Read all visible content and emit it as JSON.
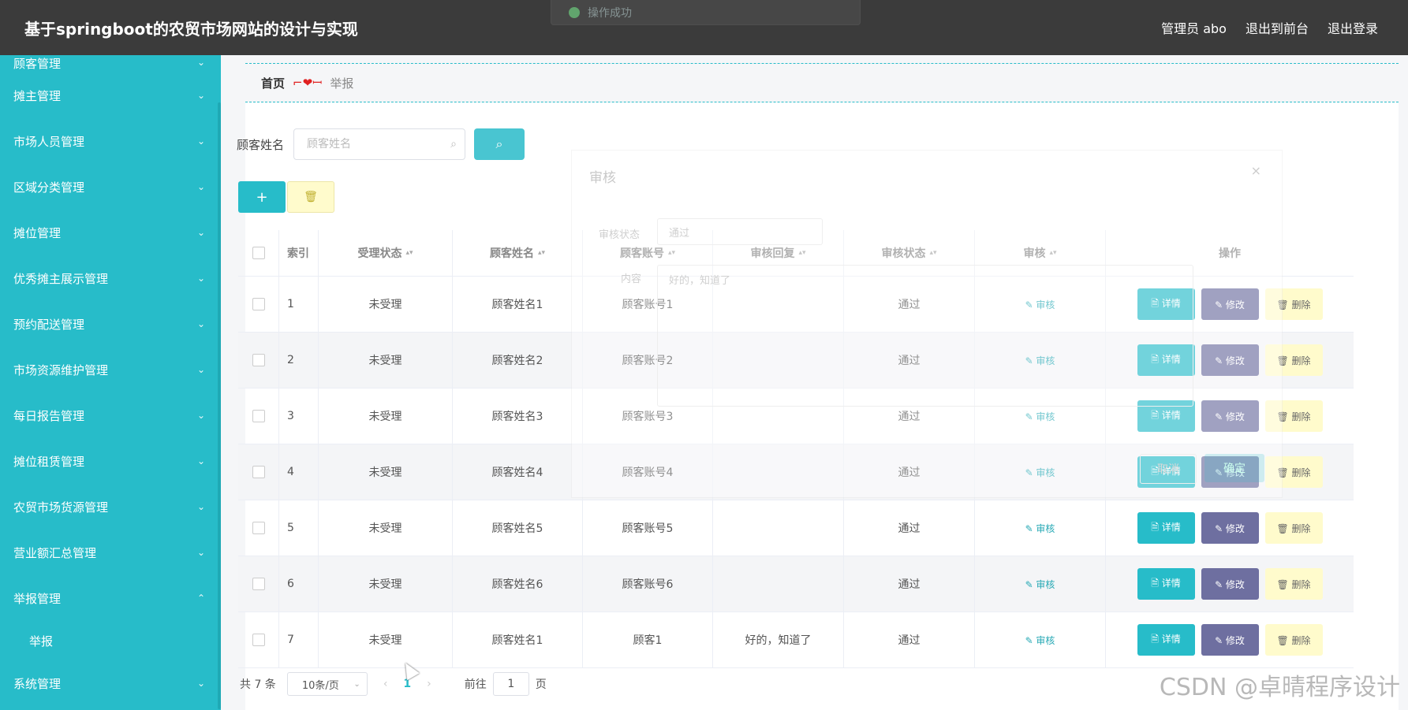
{
  "header": {
    "title": "基于springboot的农贸市场网站的设计与实现",
    "user": "管理员 abo",
    "to_front": "退出到前台",
    "logout": "退出登录"
  },
  "toast": {
    "text": "操作成功"
  },
  "sidebar": {
    "items": [
      {
        "label": "顾客管理"
      },
      {
        "label": "摊主管理"
      },
      {
        "label": "市场人员管理"
      },
      {
        "label": "区域分类管理"
      },
      {
        "label": "摊位管理"
      },
      {
        "label": "优秀摊主展示管理"
      },
      {
        "label": "预约配送管理"
      },
      {
        "label": "市场资源维护管理"
      },
      {
        "label": "每日报告管理"
      },
      {
        "label": "摊位租赁管理"
      },
      {
        "label": "农贸市场货源管理"
      },
      {
        "label": "营业额汇总管理"
      },
      {
        "label": "举报管理"
      },
      {
        "label": "系统管理"
      }
    ],
    "sub_item": "举报",
    "chev_down": "⌄",
    "chev_up": "⌃"
  },
  "breadcrumb": {
    "home": "首页",
    "sep": "⌐❤ꟷ",
    "current": "举报"
  },
  "search": {
    "label": "顾客姓名",
    "placeholder": "顾客姓名"
  },
  "buttons": {
    "add": "+",
    "delete_icon": "🗑"
  },
  "table": {
    "headers": [
      "索引",
      "受理状态",
      "顾客姓名",
      "顾客账号",
      "审核回复",
      "审核状态",
      "审核",
      "操作"
    ],
    "sort_icon": "▴▾",
    "rows": [
      {
        "index": "1",
        "status": "未受理",
        "name": "顾客姓名1",
        "account": "顾客账号1",
        "reply": "",
        "audit_status": "通过"
      },
      {
        "index": "2",
        "status": "未受理",
        "name": "顾客姓名2",
        "account": "顾客账号2",
        "reply": "",
        "audit_status": "通过"
      },
      {
        "index": "3",
        "status": "未受理",
        "name": "顾客姓名3",
        "account": "顾客账号3",
        "reply": "",
        "audit_status": "通过"
      },
      {
        "index": "4",
        "status": "未受理",
        "name": "顾客姓名4",
        "account": "顾客账号4",
        "reply": "",
        "audit_status": "通过"
      },
      {
        "index": "5",
        "status": "未受理",
        "name": "顾客姓名5",
        "account": "顾客账号5",
        "reply": "",
        "audit_status": "通过"
      },
      {
        "index": "6",
        "status": "未受理",
        "name": "顾客姓名6",
        "account": "顾客账号6",
        "reply": "",
        "audit_status": "通过"
      },
      {
        "index": "7",
        "status": "未受理",
        "name": "顾客姓名1",
        "account": "顾客1",
        "reply": "好的，知道了",
        "audit_status": "通过"
      }
    ],
    "audit_label": "✎ 审核",
    "detail_label": "🗎 详情",
    "edit_label": "✎ 修改",
    "delete_label": "🗑 删除"
  },
  "pagination": {
    "total": "共 7 条",
    "page_size": "10条/页",
    "prev": "‹",
    "current": "1",
    "next": "›",
    "goto_prefix": "前往",
    "goto_value": "1",
    "goto_suffix": "页"
  },
  "dialog": {
    "title": "审核",
    "close": "×",
    "status_label": "审核状态",
    "status_value": "通过",
    "content_label": "内容",
    "content_value": "好的，知道了",
    "cancel": "取消",
    "confirm": "确定"
  },
  "watermark": "CSDN @卓晴程序设计"
}
